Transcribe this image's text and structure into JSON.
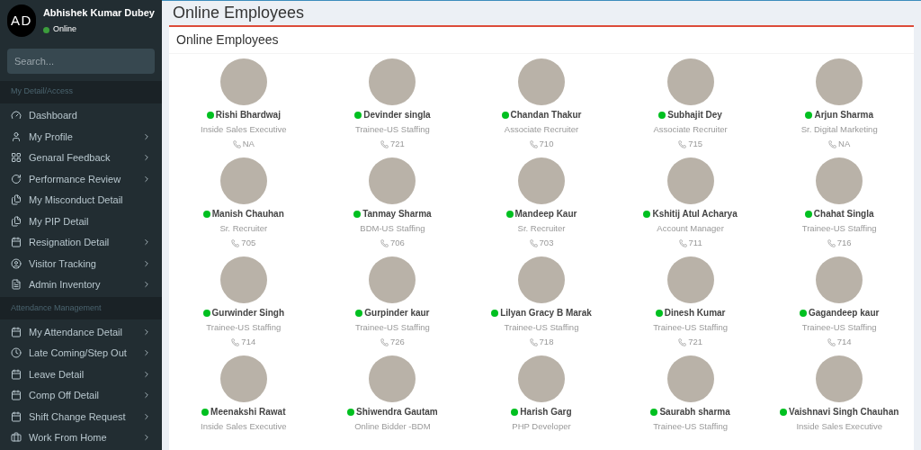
{
  "user_panel": {
    "logo": "AD",
    "name": "Abhishek Kumar Dubey",
    "status": "Online",
    "online": true
  },
  "search": {
    "placeholder": "Search..."
  },
  "sidebar": {
    "sections": [
      {
        "header": "My Detail/Access",
        "items": [
          {
            "label": "Dashboard",
            "has_submenu": false
          },
          {
            "label": "My Profile",
            "has_submenu": true
          },
          {
            "label": "Genaral Feedback",
            "has_submenu": true
          },
          {
            "label": "Performance Review",
            "has_submenu": true
          },
          {
            "label": "My Misconduct Detail",
            "has_submenu": false
          },
          {
            "label": "My PIP Detail",
            "has_submenu": false
          },
          {
            "label": "Resignation Detail",
            "has_submenu": true
          },
          {
            "label": "Visitor Tracking",
            "has_submenu": true
          },
          {
            "label": "Admin Inventory",
            "has_submenu": true
          }
        ]
      },
      {
        "header": "Attendance Management",
        "items": [
          {
            "label": "My Attendance Detail",
            "has_submenu": true
          },
          {
            "label": "Late Coming/Step Out",
            "has_submenu": true
          },
          {
            "label": "Leave Detail",
            "has_submenu": true
          },
          {
            "label": "Comp Off Detail",
            "has_submenu": true
          },
          {
            "label": "Shift Change Request",
            "has_submenu": true
          },
          {
            "label": "Work From Home",
            "has_submenu": true
          }
        ]
      }
    ]
  },
  "page_title": "Online Employees",
  "box": {
    "title": "Online Employees",
    "employees": [
      {
        "name": "Rishi Bhardwaj",
        "role": "Inside Sales Executive",
        "phone": "NA",
        "online": true
      },
      {
        "name": "Devinder singla",
        "role": "Trainee-US Staffing",
        "phone": "721",
        "online": true
      },
      {
        "name": "Chandan Thakur",
        "role": "Associate Recruiter",
        "phone": "710",
        "online": true
      },
      {
        "name": "Subhajit Dey",
        "role": "Associate Recruiter",
        "phone": "715",
        "online": true
      },
      {
        "name": "Arjun Sharma",
        "role": "Sr. Digital Marketing",
        "phone": "NA",
        "online": true
      },
      {
        "name": "Manish Chauhan",
        "role": "Sr. Recruiter",
        "phone": "705",
        "online": true
      },
      {
        "name": "Tanmay Sharma",
        "role": "BDM-US Staffing",
        "phone": "706",
        "online": true
      },
      {
        "name": "Mandeep Kaur",
        "role": "Sr. Recruiter",
        "phone": "703",
        "online": true
      },
      {
        "name": "Kshitij Atul Acharya",
        "role": "Account Manager",
        "phone": "711",
        "online": true
      },
      {
        "name": "Chahat Singla",
        "role": "Trainee-US Staffing",
        "phone": "716",
        "online": true
      },
      {
        "name": "Gurwinder Singh",
        "role": "Trainee-US Staffing",
        "phone": "714",
        "online": true
      },
      {
        "name": "Gurpinder kaur",
        "role": "Trainee-US Staffing",
        "phone": "726",
        "online": true
      },
      {
        "name": "Lilyan Gracy B Marak",
        "role": "Trainee-US Staffing",
        "phone": "718",
        "online": true
      },
      {
        "name": "Dinesh Kumar",
        "role": "Trainee-US Staffing",
        "phone": "721",
        "online": true
      },
      {
        "name": "Gagandeep kaur",
        "role": "Trainee-US Staffing",
        "phone": "714",
        "online": true
      },
      {
        "name": "Meenakshi Rawat",
        "role": "Inside Sales Executive",
        "online": true
      },
      {
        "name": "Shiwendra Gautam",
        "role": "Online Bidder -BDM",
        "online": true
      },
      {
        "name": "Harish Garg",
        "role": "PHP Developer",
        "online": true
      },
      {
        "name": "Saurabh sharma",
        "role": "Trainee-US Staffing",
        "online": true
      },
      {
        "name": "Vaishnavi Singh Chauhan",
        "role": "Inside Sales Executive",
        "online": true
      }
    ]
  }
}
